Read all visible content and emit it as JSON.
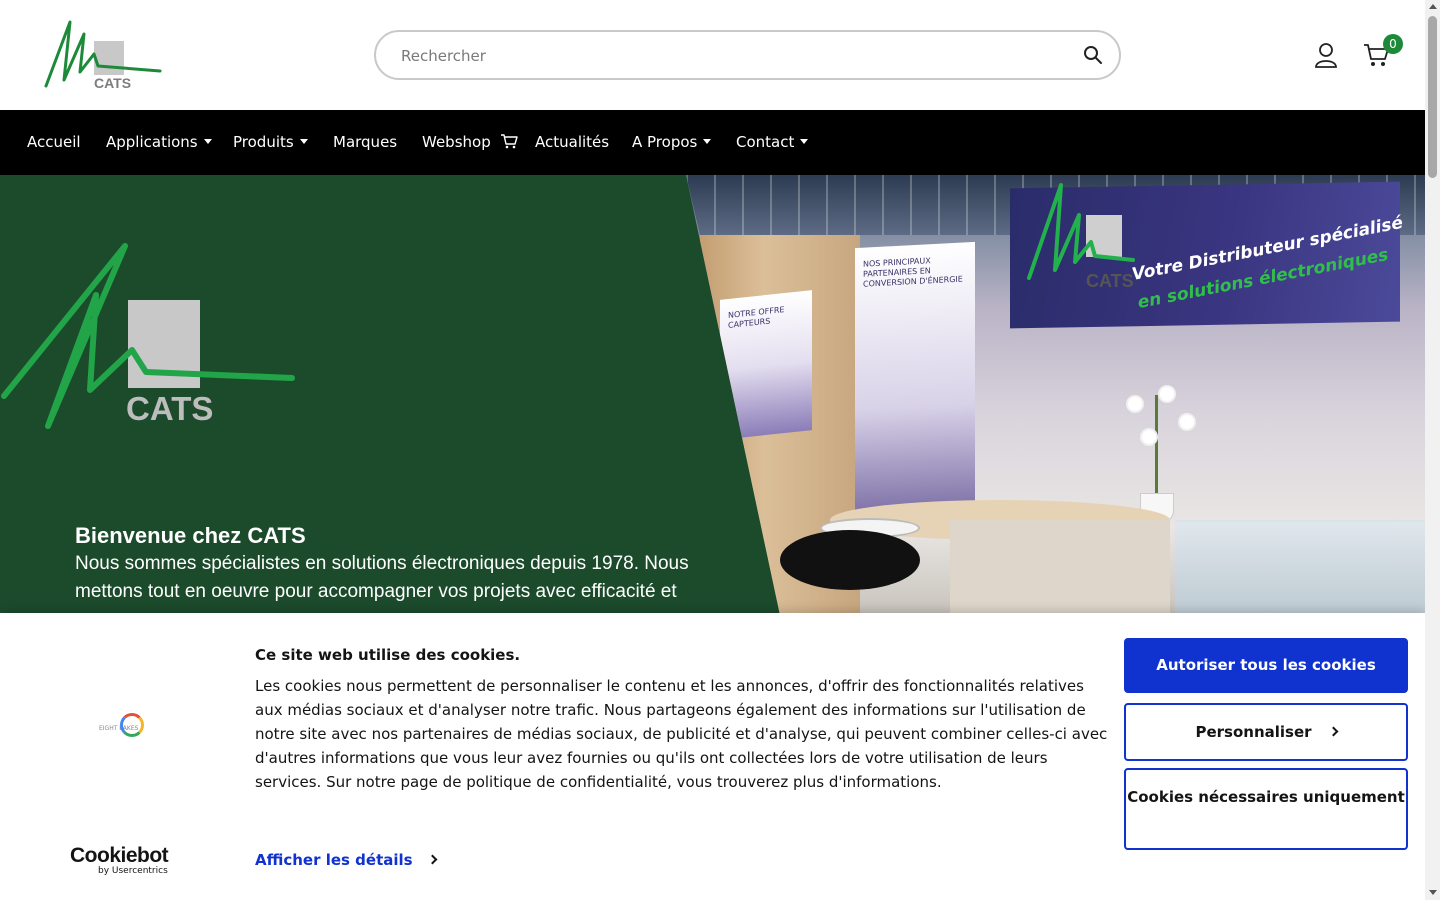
{
  "header": {
    "logo_text": "CATS",
    "search": {
      "placeholder": "Rechercher",
      "value": ""
    },
    "cart_count": "0",
    "icons": {
      "search": "search-icon",
      "user": "user-icon",
      "cart": "cart-icon"
    }
  },
  "nav": {
    "items": [
      {
        "label": "Accueil",
        "dropdown": false
      },
      {
        "label": "Applications",
        "dropdown": true
      },
      {
        "label": "Produits",
        "dropdown": true
      },
      {
        "label": "Marques",
        "dropdown": false
      },
      {
        "label": "Webshop",
        "dropdown": false,
        "icon": "cart-icon"
      },
      {
        "label": "Actualités",
        "dropdown": false
      },
      {
        "label": "A Propos",
        "dropdown": true
      },
      {
        "label": "Contact",
        "dropdown": true
      }
    ]
  },
  "hero": {
    "logo_text": "CATS",
    "title": "Bienvenue chez CATS",
    "text": "Nous sommes spécialistes en solutions électroniques depuis 1978. Nous mettons tout en oeuvre pour accompagner vos projets avec efficacité et",
    "booth_banner_line1": "Votre Distributeur spécialisé",
    "booth_banner_line2": "en solutions électroniques",
    "booth_logo_text": "CATS",
    "panel1_text": "NOS PRINCIPAUX PARTENAIRES EN CONVERSION D'ÉNERGIE",
    "panel2_text": "NOTRE OFFRE CAPTEURS"
  },
  "cookie_banner": {
    "provider_text": "EIGHT LAKES",
    "title": "Ce site web utilise des cookies.",
    "body": "Les cookies nous permettent de personnaliser le contenu et les annonces, d'offrir des fonctionnalités relatives aux médias sociaux et d'analyser notre trafic. Nous partageons également des informations sur l'utilisation de notre site avec nos partenaires de médias sociaux, de publicité et d'analyse, qui peuvent combiner celles-ci avec d'autres informations que vous leur avez fournies ou qu'ils ont collectées lors de votre utilisation de leurs services. Sur notre page de politique de confidentialité, vous trouverez plus d'informations.",
    "details_link": "Afficher les détails",
    "allow_all_button": "Autoriser tous les cookies",
    "customize_button": "Personnaliser",
    "necessary_button": "Cookies nécessaires uniquement",
    "brand": "Cookiebot",
    "brand_sub": "by Usercentrics"
  },
  "colors": {
    "brand_green": "#1d8a3a",
    "hero_green": "#1c4b2c",
    "nav_bg": "#000000",
    "cookie_blue": "#1032cf"
  }
}
